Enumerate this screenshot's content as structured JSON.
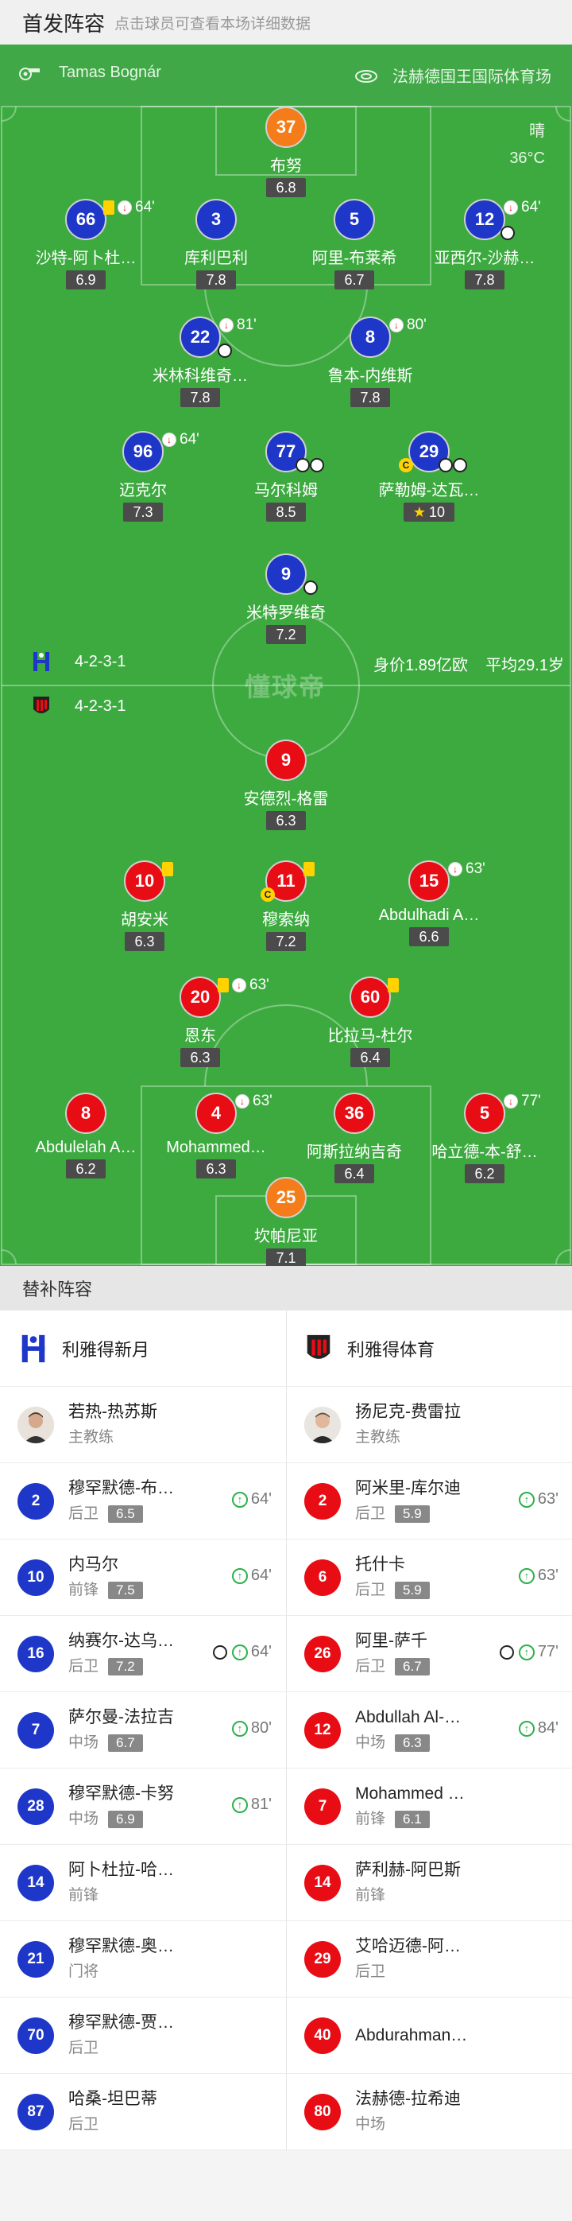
{
  "header": {
    "title": "首发阵容",
    "hint": "点击球员可查看本场详细数据"
  },
  "match_info": {
    "referee": "Tamas Bognár",
    "stadium": "法赫德国王国际体育场",
    "weather": "晴",
    "temperature": "36°C"
  },
  "watermark": "懂球帝",
  "home_team": {
    "formation": "4-2-3-1",
    "value": "身价1.89亿欧",
    "avg_age": "平均29.1岁"
  },
  "away_team": {
    "formation": "4-2-3-1"
  },
  "home_players": [
    {
      "num": "37",
      "name": "布努",
      "rating": "6.8"
    },
    {
      "num": "66",
      "name": "沙特-阿卜杜…",
      "rating": "6.9",
      "sub_min": "64'"
    },
    {
      "num": "3",
      "name": "库利巴利",
      "rating": "7.8"
    },
    {
      "num": "5",
      "name": "阿里-布莱希",
      "rating": "6.7"
    },
    {
      "num": "12",
      "name": "亚西尔-沙赫…",
      "rating": "7.8",
      "sub_min": "64'"
    },
    {
      "num": "22",
      "name": "米林科维奇…",
      "rating": "7.8",
      "sub_min": "81'"
    },
    {
      "num": "8",
      "name": "鲁本-内维斯",
      "rating": "7.8",
      "sub_min": "80'"
    },
    {
      "num": "96",
      "name": "迈克尔",
      "rating": "7.3",
      "sub_min": "64'"
    },
    {
      "num": "77",
      "name": "马尔科姆",
      "rating": "8.5"
    },
    {
      "num": "29",
      "name": "萨勒姆-达瓦…",
      "rating": "10"
    },
    {
      "num": "9",
      "name": "米特罗维奇",
      "rating": "7.2"
    }
  ],
  "away_players": [
    {
      "num": "9",
      "name": "安德烈-格雷",
      "rating": "6.3"
    },
    {
      "num": "10",
      "name": "胡安米",
      "rating": "6.3"
    },
    {
      "num": "11",
      "name": "穆索纳",
      "rating": "7.2"
    },
    {
      "num": "15",
      "name": "Abdulhadi A…",
      "rating": "6.6",
      "sub_min": "63'"
    },
    {
      "num": "20",
      "name": "恩东",
      "rating": "6.3",
      "sub_min": "63'"
    },
    {
      "num": "60",
      "name": "比拉马-杜尔",
      "rating": "6.4"
    },
    {
      "num": "8",
      "name": "Abdulelah A…",
      "rating": "6.2"
    },
    {
      "num": "4",
      "name": "Mohammed…",
      "rating": "6.3",
      "sub_min": "63'"
    },
    {
      "num": "36",
      "name": "阿斯拉纳吉奇",
      "rating": "6.4"
    },
    {
      "num": "5",
      "name": "哈立德-本-舒…",
      "rating": "6.2",
      "sub_min": "77'"
    },
    {
      "num": "25",
      "name": "坎帕尼亚",
      "rating": "7.1"
    }
  ],
  "subs": {
    "title": "替补阵容",
    "home": {
      "team_name": "利雅得新月",
      "coach": {
        "name": "若热-热苏斯",
        "role": "主教练"
      },
      "players": [
        {
          "num": "2",
          "name": "穆罕默德-布…",
          "pos": "后卫",
          "rating": "6.5",
          "min": "64'"
        },
        {
          "num": "10",
          "name": "内马尔",
          "pos": "前锋",
          "rating": "7.5",
          "min": "64'"
        },
        {
          "num": "16",
          "name": "纳赛尔-达乌…",
          "pos": "后卫",
          "rating": "7.2",
          "min": "64'"
        },
        {
          "num": "7",
          "name": "萨尔曼-法拉吉",
          "pos": "中场",
          "rating": "6.7",
          "min": "80'"
        },
        {
          "num": "28",
          "name": "穆罕默德-卡努",
          "pos": "中场",
          "rating": "6.9",
          "min": "81'"
        },
        {
          "num": "14",
          "name": "阿卜杜拉-哈…",
          "pos": "前锋"
        },
        {
          "num": "21",
          "name": "穆罕默德-奥…",
          "pos": "门将"
        },
        {
          "num": "70",
          "name": "穆罕默德-贾…",
          "pos": "后卫"
        },
        {
          "num": "87",
          "name": "哈桑-坦巴蒂",
          "pos": "后卫"
        }
      ]
    },
    "away": {
      "team_name": "利雅得体育",
      "coach": {
        "name": "扬尼克-费雷拉",
        "role": "主教练"
      },
      "players": [
        {
          "num": "2",
          "name": "阿米里-库尔迪",
          "pos": "后卫",
          "rating": "5.9",
          "min": "63'"
        },
        {
          "num": "6",
          "name": "托什卡",
          "pos": "后卫",
          "rating": "5.9",
          "min": "63'"
        },
        {
          "num": "26",
          "name": "阿里-萨千",
          "pos": "后卫",
          "rating": "6.7",
          "min": "77'"
        },
        {
          "num": "12",
          "name": "Abdullah Al-…",
          "pos": "中场",
          "rating": "6.3",
          "min": "84'"
        },
        {
          "num": "7",
          "name": "Mohammed …",
          "pos": "前锋",
          "rating": "6.1"
        },
        {
          "num": "14",
          "name": "萨利赫-阿巴斯",
          "pos": "前锋"
        },
        {
          "num": "29",
          "name": "艾哈迈德-阿…",
          "pos": "后卫"
        },
        {
          "num": "40",
          "name": "Abdurahman…",
          "pos": ""
        },
        {
          "num": "80",
          "name": "法赫德-拉希迪",
          "pos": "中场"
        }
      ]
    }
  },
  "colors": {
    "pitch": "#3daa40",
    "home": "#1e37c8",
    "away": "#e80c14",
    "keeper": "#f57c1a"
  }
}
